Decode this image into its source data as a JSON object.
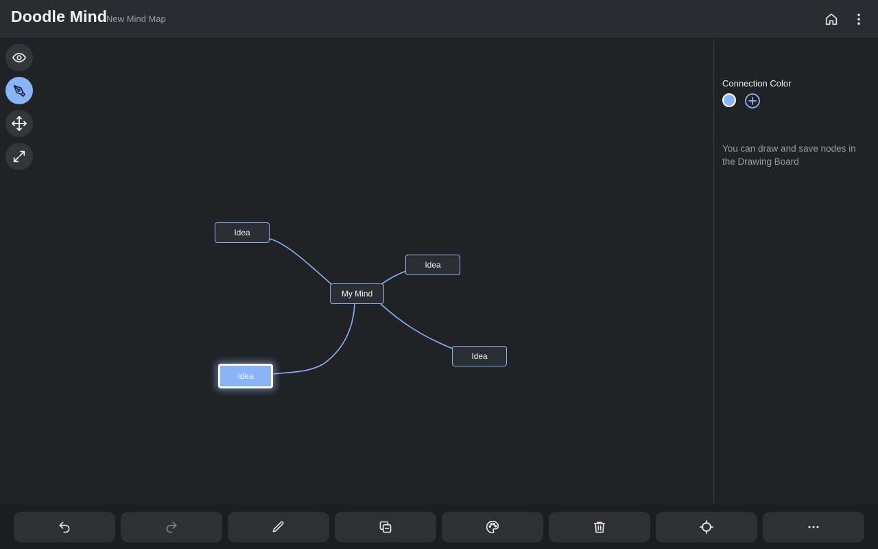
{
  "header": {
    "app_title": "Doodle Mind",
    "map_name": "New Mind Map",
    "icons": [
      "home-icon",
      "more-vertical-icon"
    ]
  },
  "tools": [
    {
      "name": "view",
      "icon": "eye-icon",
      "active": false
    },
    {
      "name": "draw",
      "icon": "pen-tool-icon",
      "active": true
    },
    {
      "name": "move",
      "icon": "move-arrows-icon",
      "active": false
    },
    {
      "name": "fit",
      "icon": "expand-icon",
      "active": false
    }
  ],
  "mindmap": {
    "root": "My Mind",
    "nodes": [
      {
        "id": "root",
        "label": "My Mind"
      },
      {
        "id": "n1",
        "label": "Idea"
      },
      {
        "id": "n2",
        "label": "Idea"
      },
      {
        "id": "n3",
        "label": "Idea"
      },
      {
        "id": "n4",
        "label": "Idea",
        "selected": true
      }
    ],
    "link_color": "#8ab4f8"
  },
  "panel": {
    "connection_color_label": "Connection Color",
    "selected_color": "#8ab4f8",
    "hint": "You can draw and save nodes in the Drawing Board"
  },
  "bottom_actions": [
    {
      "name": "undo",
      "icon": "undo-icon"
    },
    {
      "name": "redo",
      "icon": "redo-icon",
      "disabled": true
    },
    {
      "name": "edit",
      "icon": "pencil-icon"
    },
    {
      "name": "duplicate",
      "icon": "copy-icon"
    },
    {
      "name": "palette",
      "icon": "palette-icon"
    },
    {
      "name": "delete",
      "icon": "trash-icon"
    },
    {
      "name": "center",
      "icon": "crosshair-icon"
    },
    {
      "name": "more",
      "icon": "more-horizontal-icon"
    }
  ],
  "colors": {
    "accent": "#8ab4f8",
    "background": "#212226",
    "topbar": "#2b2c31"
  }
}
